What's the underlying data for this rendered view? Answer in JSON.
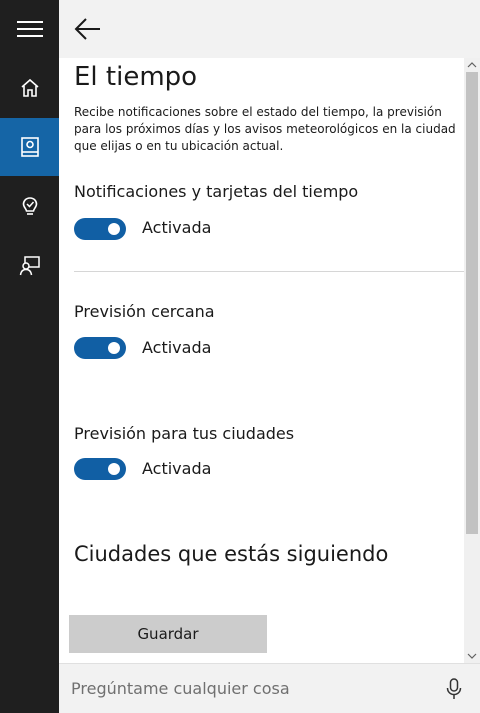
{
  "sidebar": {
    "items": [
      {
        "icon": "hamburger-menu-icon",
        "active": false
      },
      {
        "icon": "home-icon",
        "active": false
      },
      {
        "icon": "notebook-icon",
        "active": true
      },
      {
        "icon": "lightbulb-icon",
        "active": false
      },
      {
        "icon": "feedback-icon",
        "active": false
      }
    ],
    "active_color": "#1565a6",
    "background": "#1f1f1f"
  },
  "header": {
    "back_icon": "back-arrow-icon"
  },
  "main": {
    "title": "El tiempo",
    "description": "Recibe notificaciones sobre el estado del tiempo, la previsión para los próximos días y los avisos meteorológicos en la ciudad que elijas o en tu ubicación actual.",
    "settings": [
      {
        "label": "Notificaciones y tarjetas del tiempo",
        "state": "Activada",
        "on": true
      },
      {
        "label": "Previsión cercana",
        "state": "Activada",
        "on": true
      },
      {
        "label": "Previsión para tus ciudades",
        "state": "Activada",
        "on": true
      }
    ],
    "section_heading": "Ciudades que estás siguiendo",
    "save_label": "Guardar"
  },
  "search": {
    "placeholder": "Pregúntame cualquier cosa",
    "mic_icon": "microphone-icon"
  },
  "colors": {
    "toggle_on": "#115fa4",
    "save_button": "#cccccc"
  }
}
